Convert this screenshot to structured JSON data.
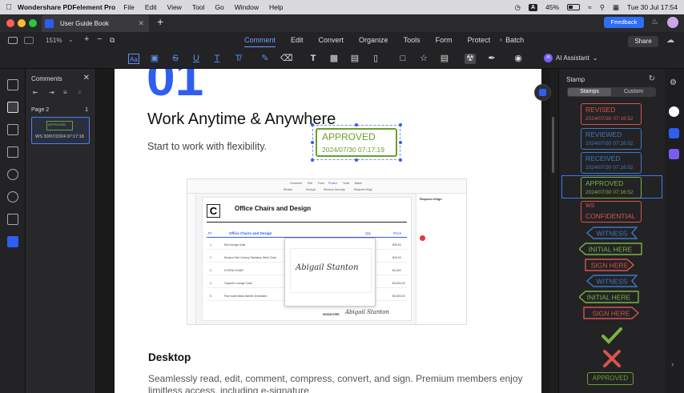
{
  "menubar": {
    "app_name": "Wondershare PDFelement Pro",
    "items": [
      "File",
      "Edit",
      "View",
      "Tool",
      "Go",
      "Window",
      "Help"
    ],
    "battery": "45%",
    "battery_level": 0.45,
    "input_source": "A",
    "clock": "Tue 30 Jul  17:54"
  },
  "tabbar": {
    "tab_title": "User Guide Book",
    "feedback_label": "Feedback"
  },
  "toolbar": {
    "zoom": "151%",
    "tabs": [
      "Comment",
      "Edit",
      "Convert",
      "Organize",
      "Tools",
      "Form",
      "Protect",
      "Batch"
    ],
    "active_tab": "Comment",
    "share_label": "Share",
    "ai_label": "AI Assistant",
    "ai_badge": "AI"
  },
  "comments_panel": {
    "title": "Comments",
    "page_label": "Page 2",
    "page_count": "1",
    "card_stamp_text": "APPROVED",
    "card_meta": "WS 30/07/2024 07:17:18"
  },
  "document": {
    "big_number": "01",
    "heading": "Work Anytime & Anywhere",
    "subheading": "Start to work with flexibility.",
    "stamp_title": "APPROVED",
    "stamp_date": "2024/07/30 07:17:19",
    "section_heading": "Desktop",
    "paragraph": "Seamlessly read, edit, comment, compress, convert, and sign. Premium members enjoy limitless access, including e-signature"
  },
  "embedded_screenshot": {
    "toolbar_items": [
      "Comment",
      "Edit",
      "Form",
      "Protect",
      "Tools",
      "Batch"
    ],
    "toolbar_sub": [
      "Redact",
      "Encrypt",
      "Remove Security",
      "Request eSign"
    ],
    "company_title": "Office Chairs and Design",
    "table_headers": [
      "PI.",
      "Office Chairs and Design",
      "Qty",
      "Price"
    ],
    "rows": [
      "Red lounge chair",
      "Modern Mid Century Stainless Steel Chair",
      "HYDRA CHAIR",
      "Capsule Lounge Chair",
      "Flat mode Black Barber Armchairs"
    ],
    "prices": [
      "$35.00",
      "$15.00",
      "$4,300",
      "$3,530.00",
      "$4,500.00"
    ],
    "side_panel_title": "Request eSign",
    "signature_name": "Abigail Stanton",
    "signature_label": "SIGNATURE:"
  },
  "stamp_panel": {
    "title": "Stamp",
    "tab_stamps": "Stamps",
    "tab_custom": "Custom",
    "dated_stamps": [
      {
        "label": "REVISED",
        "date": "2024/07/30 07:16:52",
        "color": "#d9534f"
      },
      {
        "label": "REVIEWED",
        "date": "2024/07/30 07:16:52",
        "color": "#3d78c5"
      },
      {
        "label": "RECEIVED",
        "date": "2024/07/30 07:16:52",
        "color": "#3d78c5"
      },
      {
        "label": "APPROVED",
        "date": "2024/07/30 07:16:52",
        "color": "#7cb342"
      }
    ],
    "confidential": {
      "line1": "WS",
      "line2": "CONFIDENTIAL",
      "color": "#d9534f"
    },
    "flags": [
      {
        "label": "WITNESS",
        "color": "#3d78c5"
      },
      {
        "label": "INITIAL HERE",
        "color": "#7cb342"
      },
      {
        "label": "SIGN HERE",
        "color": "#d9534f"
      },
      {
        "label": "WITNESS",
        "color": "#3d78c5"
      },
      {
        "label": "INITIAL HERE",
        "color": "#7cb342"
      },
      {
        "label": "SIGN HERE",
        "color": "#d9534f"
      }
    ],
    "check_color": "#7cb342",
    "cross_color": "#d9534f",
    "approved_small": "APPROVED"
  },
  "colors": {
    "accent": "#2f5ef0",
    "approved_green": "#6c9e2f"
  }
}
